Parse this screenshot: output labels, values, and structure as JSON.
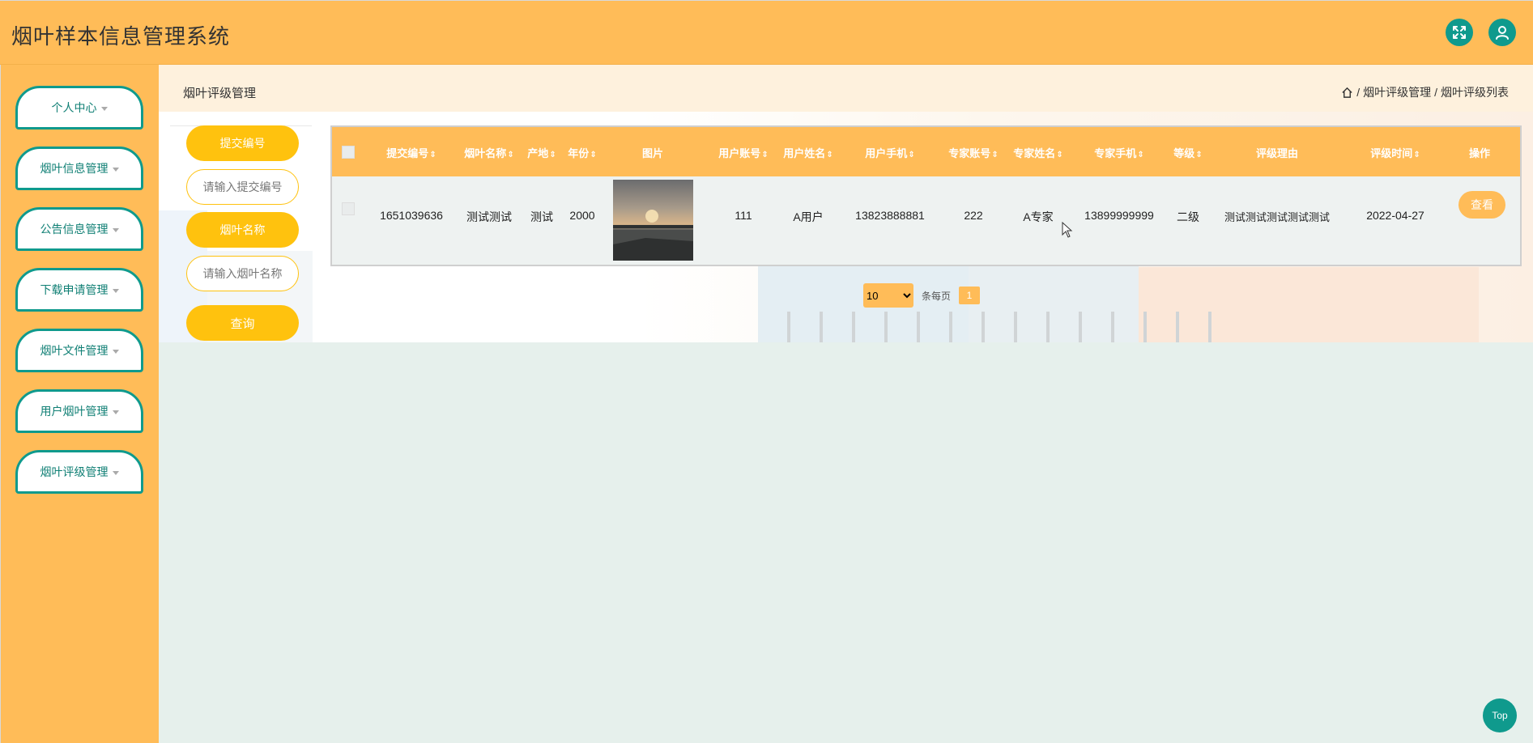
{
  "app": {
    "title": "烟叶样本信息管理系统"
  },
  "header": {
    "fullscreen_icon": "expand-icon",
    "user_icon": "user-icon"
  },
  "sidebar": {
    "items": [
      {
        "label": "个人中心"
      },
      {
        "label": "烟叶信息管理"
      },
      {
        "label": "公告信息管理"
      },
      {
        "label": "下载申请管理"
      },
      {
        "label": "烟叶文件管理"
      },
      {
        "label": "用户烟叶管理"
      },
      {
        "label": "烟叶评级管理"
      }
    ]
  },
  "page": {
    "title": "烟叶评级管理",
    "breadcrumb": [
      "烟叶评级管理",
      "烟叶评级列表"
    ],
    "breadcrumb_sep": "/"
  },
  "search": {
    "submit_no_label": "提交编号",
    "submit_no_placeholder": "请输入提交编号",
    "name_label": "烟叶名称",
    "name_placeholder": "请输入烟叶名称",
    "query_button": "查询"
  },
  "table": {
    "columns": [
      "提交编号",
      "烟叶名称",
      "产地",
      "年份",
      "图片",
      "用户账号",
      "用户姓名",
      "用户手机",
      "专家账号",
      "专家姓名",
      "专家手机",
      "等级",
      "评级理由",
      "评级时间",
      "操作"
    ],
    "sortable": [
      true,
      true,
      true,
      true,
      false,
      true,
      true,
      true,
      true,
      true,
      true,
      true,
      false,
      true,
      false
    ],
    "rows": [
      {
        "submit_no": "1651039636",
        "name": "测试测试",
        "origin": "测试",
        "year": "2000",
        "user_account": "111",
        "user_name": "A用户",
        "user_phone": "13823888881",
        "expert_account": "222",
        "expert_name": "A专家",
        "expert_phone": "13899999999",
        "grade": "二级",
        "reason": "测试测试测试测试测试",
        "time": "2022-04-27",
        "action": "查看"
      }
    ]
  },
  "pagination": {
    "page_size": "10",
    "page_size_options": [
      "10"
    ],
    "per_page_label": "条每页",
    "current_page": "1"
  },
  "top_button": "Top",
  "colors": {
    "accent": "#ffbc58",
    "teal": "#0f9a8d",
    "yellow": "#ffc20e"
  }
}
